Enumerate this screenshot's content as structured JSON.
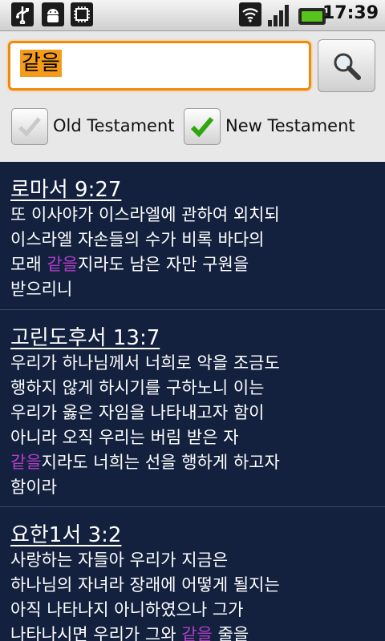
{
  "status_bar": {
    "time": "17:39",
    "icons": [
      "usb-icon",
      "android-debug-icon",
      "chip-icon",
      "wifi-icon",
      "signal-icon",
      "battery-icon"
    ]
  },
  "search": {
    "query": "같을",
    "button_icon": "magnifier-icon"
  },
  "filters": {
    "old_testament": {
      "label": "Old Testament",
      "checked": false
    },
    "new_testament": {
      "label": "New Testament",
      "checked": true
    }
  },
  "colors": {
    "highlight": "#b23ec8",
    "background": "#13213f",
    "accent": "#f08a0c"
  },
  "results": [
    {
      "reference": "로마서 9:27",
      "lines": [
        [
          "또 이사야가 이스라엘에 관하여 외치되"
        ],
        [
          "이스라엘 자손들의 수가 비록 바다의"
        ],
        [
          "모래 ",
          {
            "hl": "같을"
          },
          "지라도 남은 자만 구원을"
        ],
        [
          "받으리니"
        ]
      ]
    },
    {
      "reference": "고린도후서 13:7",
      "lines": [
        [
          "우리가 하나님께서 너희로 악을 조금도"
        ],
        [
          "행하지 않게 하시기를 구하노니 이는"
        ],
        [
          "우리가 옳은 자임을 나타내고자 함이"
        ],
        [
          "아니라 오직 우리는 버림 받은 자"
        ],
        [
          {
            "hl": "같을"
          },
          "지라도 너희는 선을 행하게 하고자"
        ],
        [
          "함이라"
        ]
      ]
    },
    {
      "reference": "요한1서 3:2",
      "lines": [
        [
          "사랑하는 자들아 우리가 지금은"
        ],
        [
          "하나님의 자녀라 장래에 어떻게 될지는"
        ],
        [
          "아직 나타나지 아니하였으나 그가"
        ],
        [
          "나타나시면 우리가 그와 ",
          {
            "hl": "같을"
          },
          " 줄을"
        ]
      ]
    }
  ]
}
